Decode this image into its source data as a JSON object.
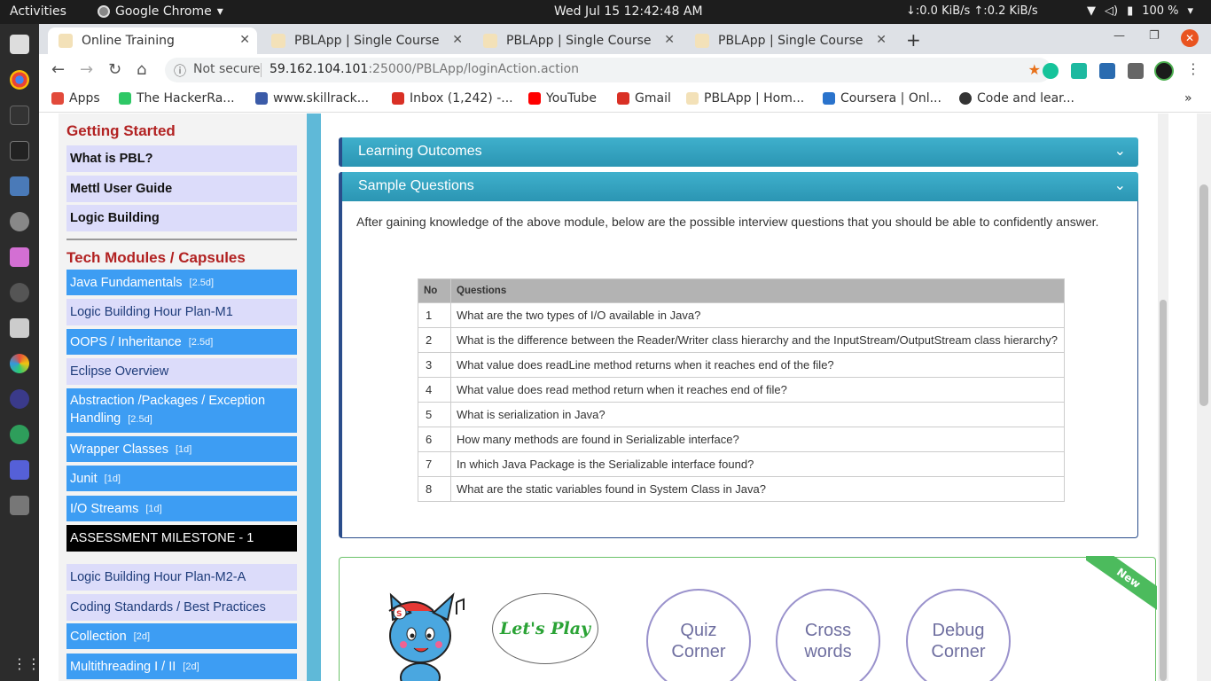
{
  "os": {
    "activities": "Activities",
    "app_name": "Google Chrome",
    "app_menu_arrow": "▾",
    "clock": "Wed Jul 15  12:42:48 AM",
    "network": "↓:0.0 KiB/s ↑:0.2 KiB/s",
    "battery": "100 %"
  },
  "browser": {
    "tabs": [
      {
        "title": "Online Training",
        "active": true
      },
      {
        "title": "PBLApp | Single Course",
        "active": false
      },
      {
        "title": "PBLApp | Single Course",
        "active": false
      },
      {
        "title": "PBLApp | Single Course",
        "active": false
      }
    ],
    "security_label": "Not secure",
    "url_host": "59.162.104.101",
    "url_rest": ":25000/PBLApp/loginAction.action",
    "bookmarks": [
      {
        "label": "Apps",
        "color": "#e24a3b"
      },
      {
        "label": "The HackerRa...",
        "color": "#2ec866"
      },
      {
        "label": "www.skillrack...",
        "color": "#3b5ba8"
      },
      {
        "label": "Inbox (1,242) -...",
        "color": "#d93025"
      },
      {
        "label": "YouTube",
        "color": "#ff0000"
      },
      {
        "label": "Gmail",
        "color": "#d93025"
      },
      {
        "label": "PBLApp | Hom...",
        "color": "#f3e1b8"
      },
      {
        "label": "Coursera | Onl...",
        "color": "#2a73cc"
      },
      {
        "label": "Code and lear...",
        "color": "#333333"
      }
    ],
    "bookmarks_more": "»"
  },
  "sidebar": {
    "getting_started": "Getting Started",
    "gs_items": [
      "What is PBL?",
      "Mettl User Guide",
      "Logic Building"
    ],
    "tech_modules": "Tech Modules / Capsules",
    "modules": [
      {
        "label": "Java Fundamentals",
        "dur": "[2.5d]",
        "style": "blue"
      },
      {
        "label": "Logic Building Hour Plan-M1",
        "dur": "",
        "style": "lav2"
      },
      {
        "label": "OOPS / Inheritance",
        "dur": "[2.5d]",
        "style": "blue"
      },
      {
        "label": "Eclipse Overview",
        "dur": "",
        "style": "lav2"
      },
      {
        "label": "Abstraction /Packages / Exception Handling",
        "dur": "[2.5d]",
        "style": "blue"
      },
      {
        "label": "Wrapper Classes",
        "dur": "[1d]",
        "style": "blue"
      },
      {
        "label": "Junit",
        "dur": "[1d]",
        "style": "blue"
      },
      {
        "label": "I/O Streams",
        "dur": "[1d]",
        "style": "blue"
      },
      {
        "label": "ASSESSMENT MILESTONE - 1",
        "dur": "",
        "style": "black"
      },
      {
        "label": "Logic Building Hour Plan-M2-A",
        "dur": "",
        "style": "lav2"
      },
      {
        "label": "Coding Standards / Best Practices",
        "dur": "",
        "style": "lav2"
      },
      {
        "label": "Collection",
        "dur": "[2d]",
        "style": "blue"
      },
      {
        "label": "Multithreading I / II",
        "dur": "[2d]",
        "style": "blue"
      }
    ]
  },
  "main": {
    "learning_outcomes": "Learning Outcomes",
    "sample_questions": "Sample Questions",
    "intro": "After gaining knowledge of the above module, below are the possible interview questions that you should be able to confidently answer.",
    "table_headers": [
      "No",
      "Questions"
    ],
    "questions": [
      {
        "no": "1",
        "q": "What are the two types of I/O available in Java?"
      },
      {
        "no": "2",
        "q": "What is the difference between the Reader/Writer class hierarchy and the InputStream/OutputStream class hierarchy?"
      },
      {
        "no": "3",
        "q": "What value does readLine method returns when it reaches end of the file?"
      },
      {
        "no": "4",
        "q": "What value does read method return when it reaches end of file?"
      },
      {
        "no": "5",
        "q": "What is serialization in Java?"
      },
      {
        "no": "6",
        "q": "How many methods are found in Serializable interface?"
      },
      {
        "no": "7",
        "q": "In which Java Package is the Serializable interface found?"
      },
      {
        "no": "8",
        "q": "What are the static variables found in System Class in Java?"
      }
    ],
    "play_bubble": "Let's Play",
    "new_badge": "New",
    "play_links": [
      "Quiz Corner",
      "Cross words",
      "Debug Corner"
    ]
  }
}
